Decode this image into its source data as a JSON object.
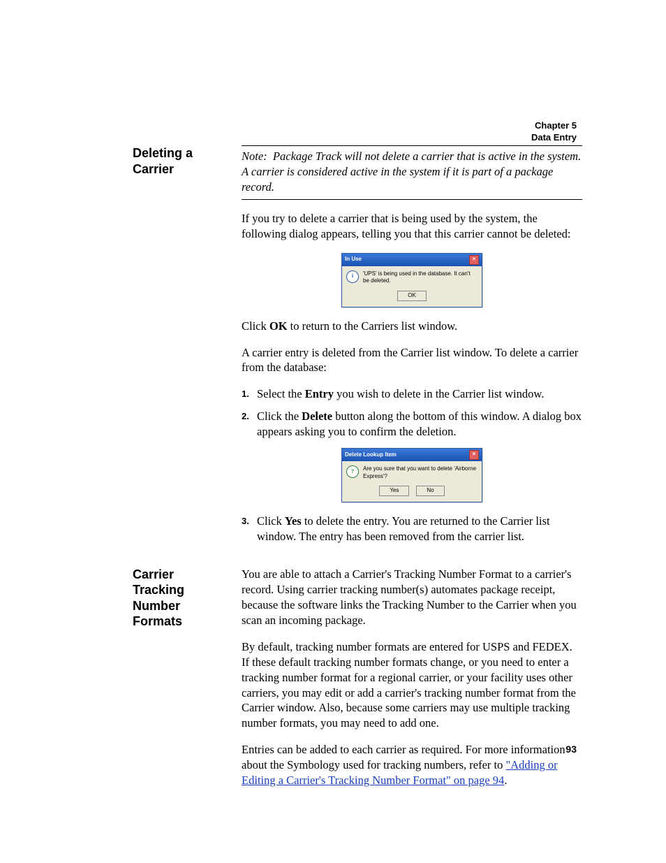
{
  "header": {
    "chapter": "Chapter 5",
    "section": "Data Entry"
  },
  "pageNumber": "93",
  "section1": {
    "heading": "Deleting a Carrier",
    "noteLabel": "Note:",
    "noteText": "Package Track will not delete a carrier that is active in the system. A carrier is considered active in the system if it is part of a package record.",
    "p1": "If you try to delete a carrier that is being used by the system, the following dialog appears, telling you that this carrier cannot be deleted:",
    "dialog1": {
      "title": "In Use",
      "message": "'UPS' is being used in the database. It can't be deleted.",
      "ok": "OK"
    },
    "p2a": "Click ",
    "p2bold": "OK",
    "p2b": " to return to the Carriers list window.",
    "p3": "A carrier entry is deleted from the Carrier list window. To delete a carrier from the database:",
    "steps": {
      "n1": "1.",
      "s1a": "Select the ",
      "s1bold": "Entry",
      "s1b": " you wish to delete in the Carrier list window.",
      "n2": "2.",
      "s2a": "Click the ",
      "s2bold": "Delete",
      "s2b": " button along the bottom of this window. A dialog box appears asking you to confirm the deletion.",
      "n3": "3.",
      "s3a": "Click ",
      "s3bold": "Yes",
      "s3b": " to delete the entry. You are returned to the Carrier list window. The entry has been removed from the carrier list."
    },
    "dialog2": {
      "title": "Delete Lookup Item",
      "message": "Are you sure that you want to delete 'Airborne Express'?",
      "yes": "Yes",
      "no": "No"
    }
  },
  "section2": {
    "heading": "Carrier Tracking Number Formats",
    "p1": "You are able to attach a Carrier's Tracking Number Format to a carrier's record. Using carrier tracking number(s) automates package receipt, because the software links the Tracking Number to the Carrier when you scan an incoming package.",
    "p2": "By default, tracking number formats are entered for USPS and FEDEX. If these default tracking number formats change, or you need to enter a tracking number format for a regional carrier, or your facility uses other carriers, you may edit or add a carrier's tracking number format from the Carrier window. Also, because some carriers may use multiple tracking number formats, you may need to add one.",
    "p3a": "Entries can be added to each carrier as required. For more information about the Symbology used for tracking numbers, refer to ",
    "p3link": "\"Adding or Editing a Carrier's Tracking Number Format\" on page 94",
    "p3b": "."
  }
}
